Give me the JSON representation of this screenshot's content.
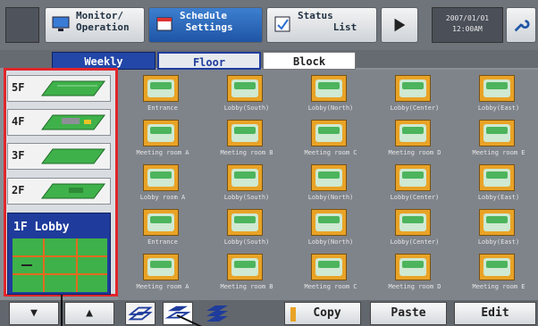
{
  "topbar": {
    "monitor_label": "Monitor/\nOperation",
    "schedule_label": "Schedule\n Settings",
    "status_label": "Status\n      List",
    "clock_line1": "2007/01/01",
    "clock_line2": "12:00AM"
  },
  "tabs": [
    {
      "label": "Weekly"
    },
    {
      "label": "Floor"
    },
    {
      "label": "Block"
    }
  ],
  "floors": [
    {
      "label": "5F"
    },
    {
      "label": "4F"
    },
    {
      "label": "3F"
    },
    {
      "label": "2F"
    },
    {
      "label": "1F Lobby"
    }
  ],
  "units": [
    {
      "name": "Entrance"
    },
    {
      "name": "Lobby(South)"
    },
    {
      "name": "Lobby(North)"
    },
    {
      "name": "Lobby(Center)"
    },
    {
      "name": "Lobby(East)"
    },
    {
      "name": "Meeting room A"
    },
    {
      "name": "Meeting room B"
    },
    {
      "name": "Meeting room C"
    },
    {
      "name": "Meeting room D"
    },
    {
      "name": "Meeting room E"
    },
    {
      "name": "Lobby room A"
    },
    {
      "name": "Lobby(South)"
    },
    {
      "name": "Lobby(North)"
    },
    {
      "name": "Lobby(Center)"
    },
    {
      "name": "Lobby(East)"
    },
    {
      "name": "Entrance"
    },
    {
      "name": "Lobby(South)"
    },
    {
      "name": "Lobby(North)"
    },
    {
      "name": "Lobby(Center)"
    },
    {
      "name": "Lobby(East)"
    },
    {
      "name": "Meeting room A"
    },
    {
      "name": "Meeting room B"
    },
    {
      "name": "Meeting room C"
    },
    {
      "name": "Meeting room D"
    },
    {
      "name": "Meeting room E"
    }
  ],
  "bottombar": {
    "down_glyph": "▼",
    "up_glyph": "▲",
    "copy_label": "Copy",
    "paste_label": "Paste",
    "edit_label": "Edit"
  },
  "colors": {
    "accent_red": "#e0262b",
    "selected_blue": "#1f3c9c",
    "unit_orange": "#e9a326",
    "floor_green": "#3fb14a"
  }
}
